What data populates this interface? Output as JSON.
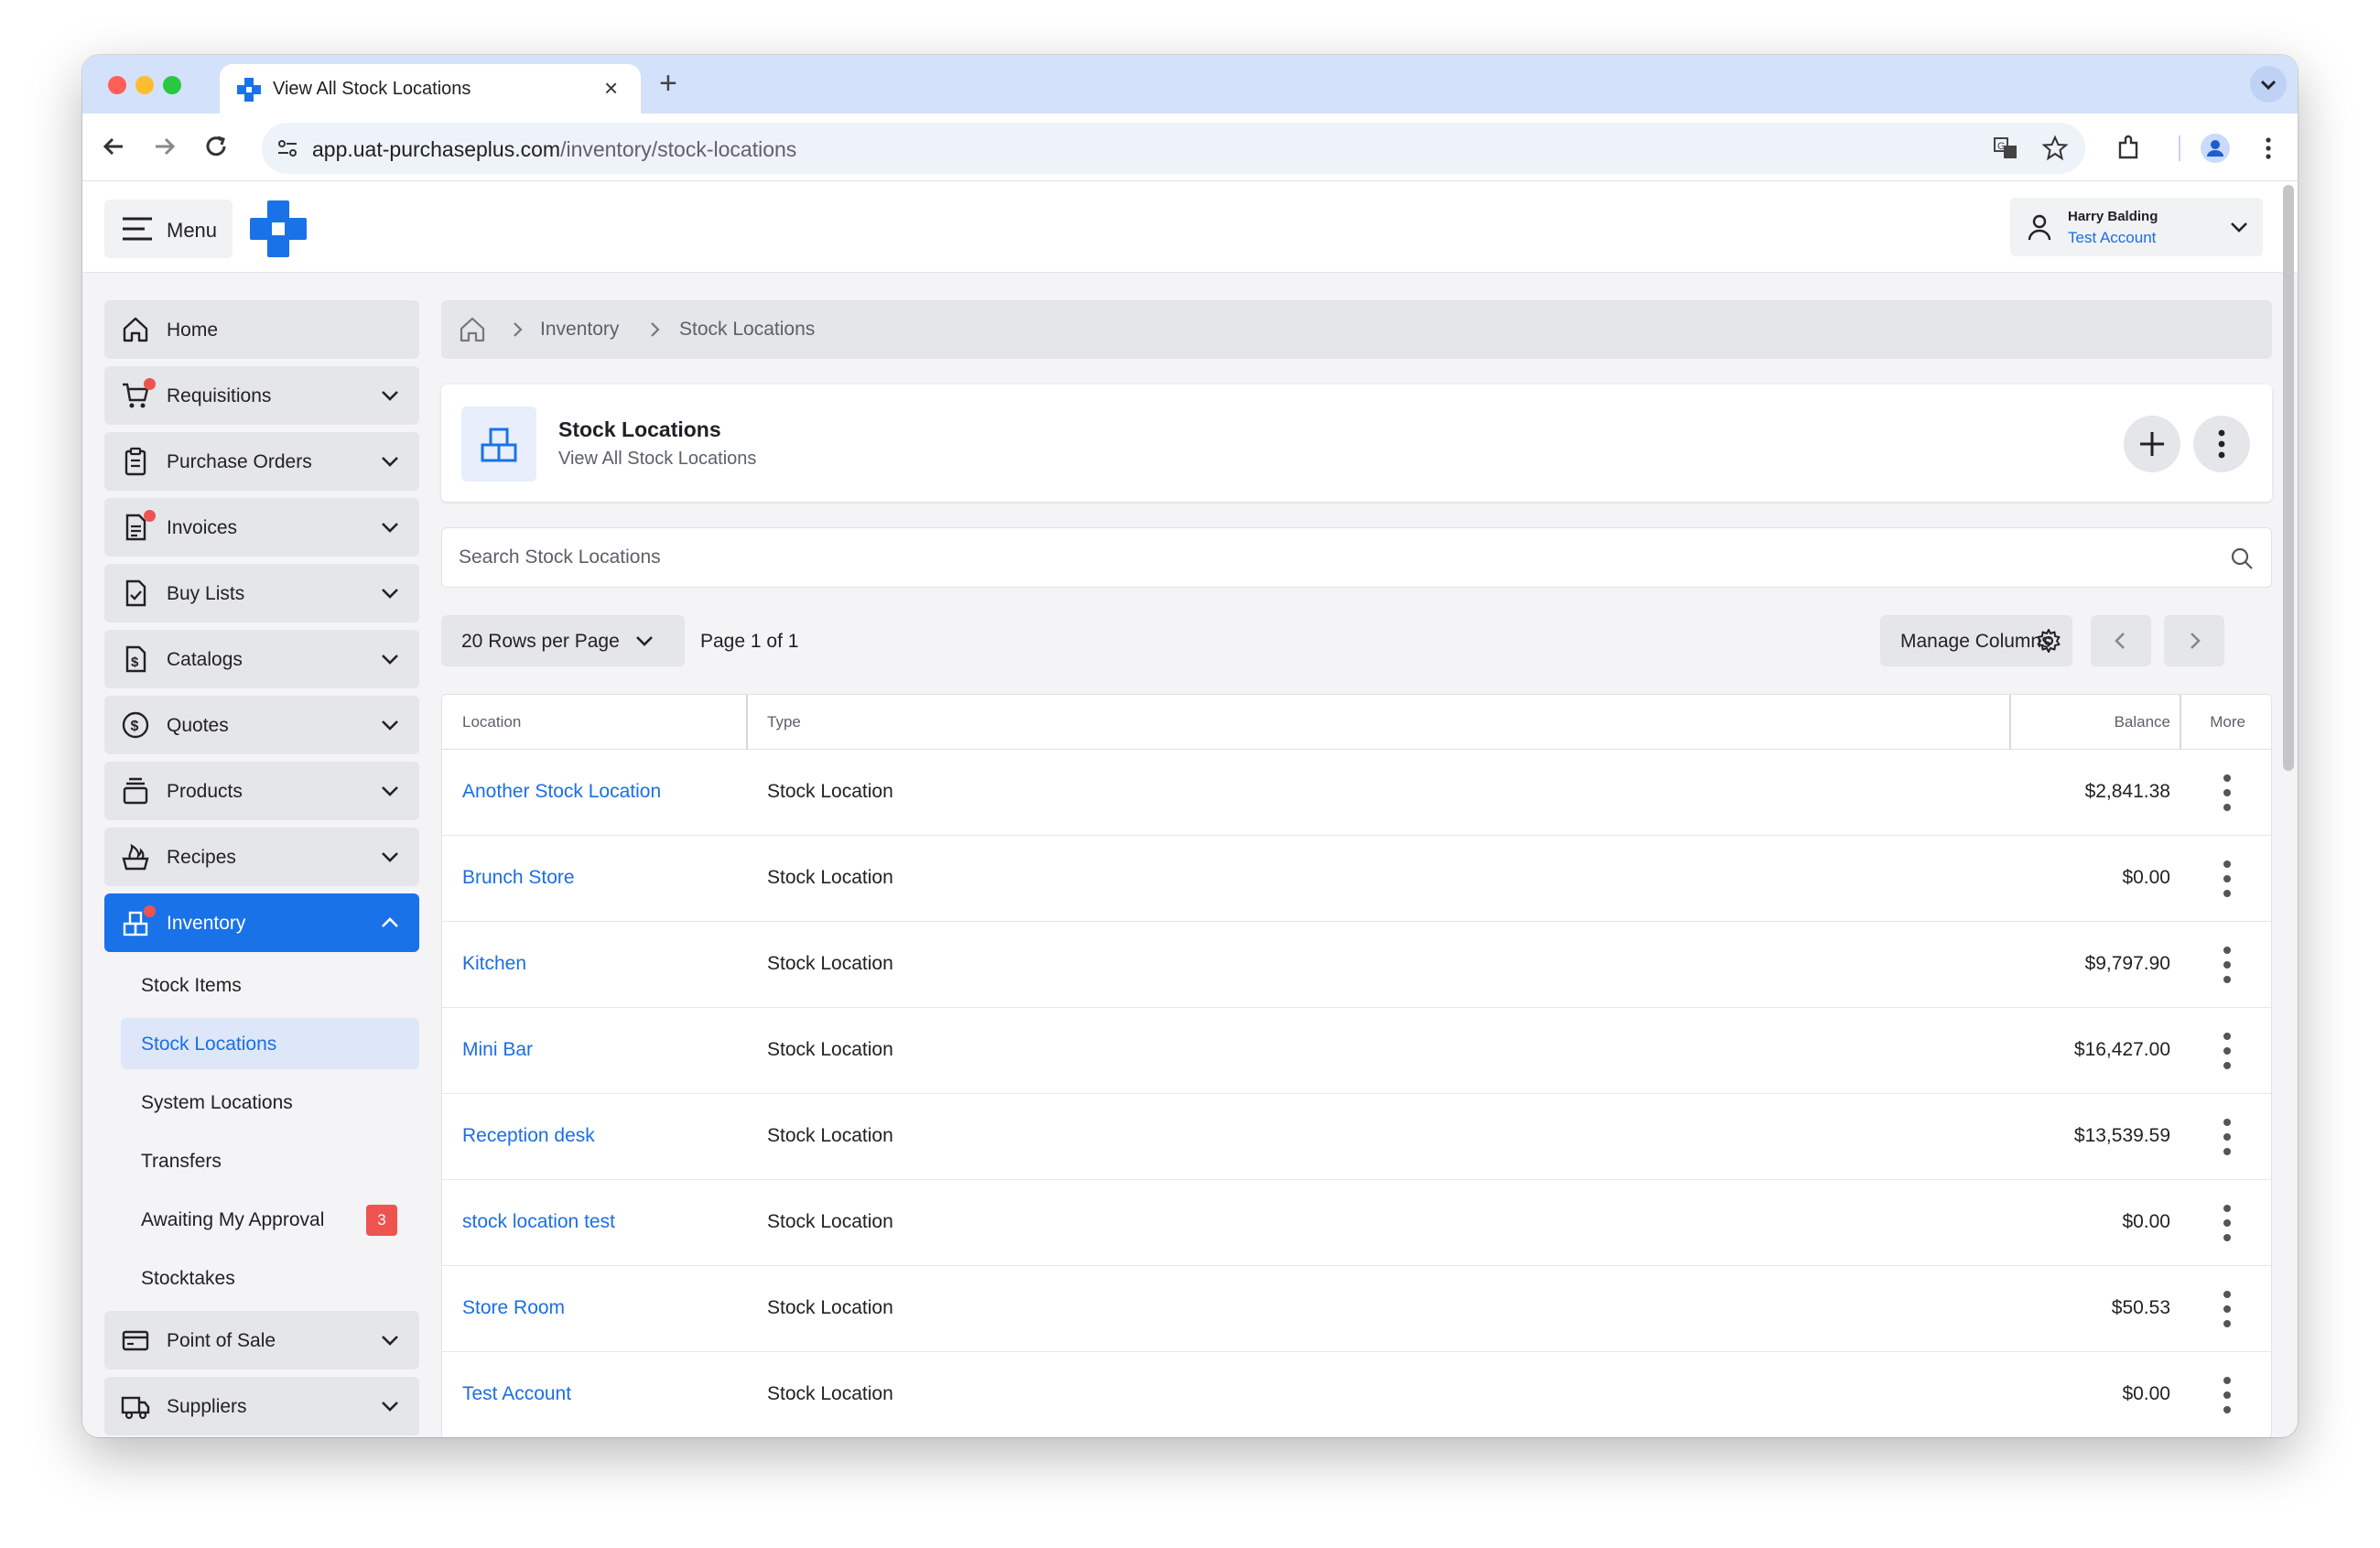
{
  "browser": {
    "tab_title": "View All Stock Locations",
    "url_host": "app.uat-purchaseplus.com",
    "url_path": "/inventory/stock-locations"
  },
  "topbar": {
    "menu_label": "Menu",
    "user_name": "Harry Balding",
    "user_account": "Test Account"
  },
  "sidebar": {
    "items": [
      {
        "label": "Home"
      },
      {
        "label": "Requisitions"
      },
      {
        "label": "Purchase Orders"
      },
      {
        "label": "Invoices"
      },
      {
        "label": "Buy Lists"
      },
      {
        "label": "Catalogs"
      },
      {
        "label": "Quotes"
      },
      {
        "label": "Products"
      },
      {
        "label": "Recipes"
      },
      {
        "label": "Inventory"
      },
      {
        "label": "Point of Sale"
      },
      {
        "label": "Suppliers"
      }
    ],
    "inventory_sub": [
      {
        "label": "Stock Items"
      },
      {
        "label": "Stock Locations"
      },
      {
        "label": "System Locations"
      },
      {
        "label": "Transfers"
      },
      {
        "label": "Awaiting My Approval",
        "badge": "3"
      },
      {
        "label": "Stocktakes"
      }
    ]
  },
  "breadcrumb": {
    "items": [
      "Inventory",
      "Stock Locations"
    ]
  },
  "page": {
    "title": "Stock Locations",
    "subtitle": "View All Stock Locations"
  },
  "search": {
    "placeholder": "Search Stock Locations"
  },
  "pagination": {
    "rows_label": "20 Rows per Page",
    "page_info": "Page 1 of 1",
    "manage_columns": "Manage Columns"
  },
  "table": {
    "headers": {
      "location": "Location",
      "type": "Type",
      "balance": "Balance",
      "more": "More"
    },
    "rows": [
      {
        "location": "Another Stock Location",
        "type": "Stock Location",
        "balance": "$2,841.38"
      },
      {
        "location": "Brunch Store",
        "type": "Stock Location",
        "balance": "$0.00"
      },
      {
        "location": "Kitchen",
        "type": "Stock Location",
        "balance": "$9,797.90"
      },
      {
        "location": "Mini Bar",
        "type": "Stock Location",
        "balance": "$16,427.00"
      },
      {
        "location": "Reception desk",
        "type": "Stock Location",
        "balance": "$13,539.59"
      },
      {
        "location": "stock location test",
        "type": "Stock Location",
        "balance": "$0.00"
      },
      {
        "location": "Store Room",
        "type": "Stock Location",
        "balance": "$50.53"
      },
      {
        "location": "Test Account",
        "type": "Stock Location",
        "balance": "$0.00"
      }
    ]
  },
  "colors": {
    "accent": "#1a72e8",
    "link": "#1b6ee6",
    "alert": "#ef5350",
    "sidebar_item_bg": "#e5e6ea"
  }
}
